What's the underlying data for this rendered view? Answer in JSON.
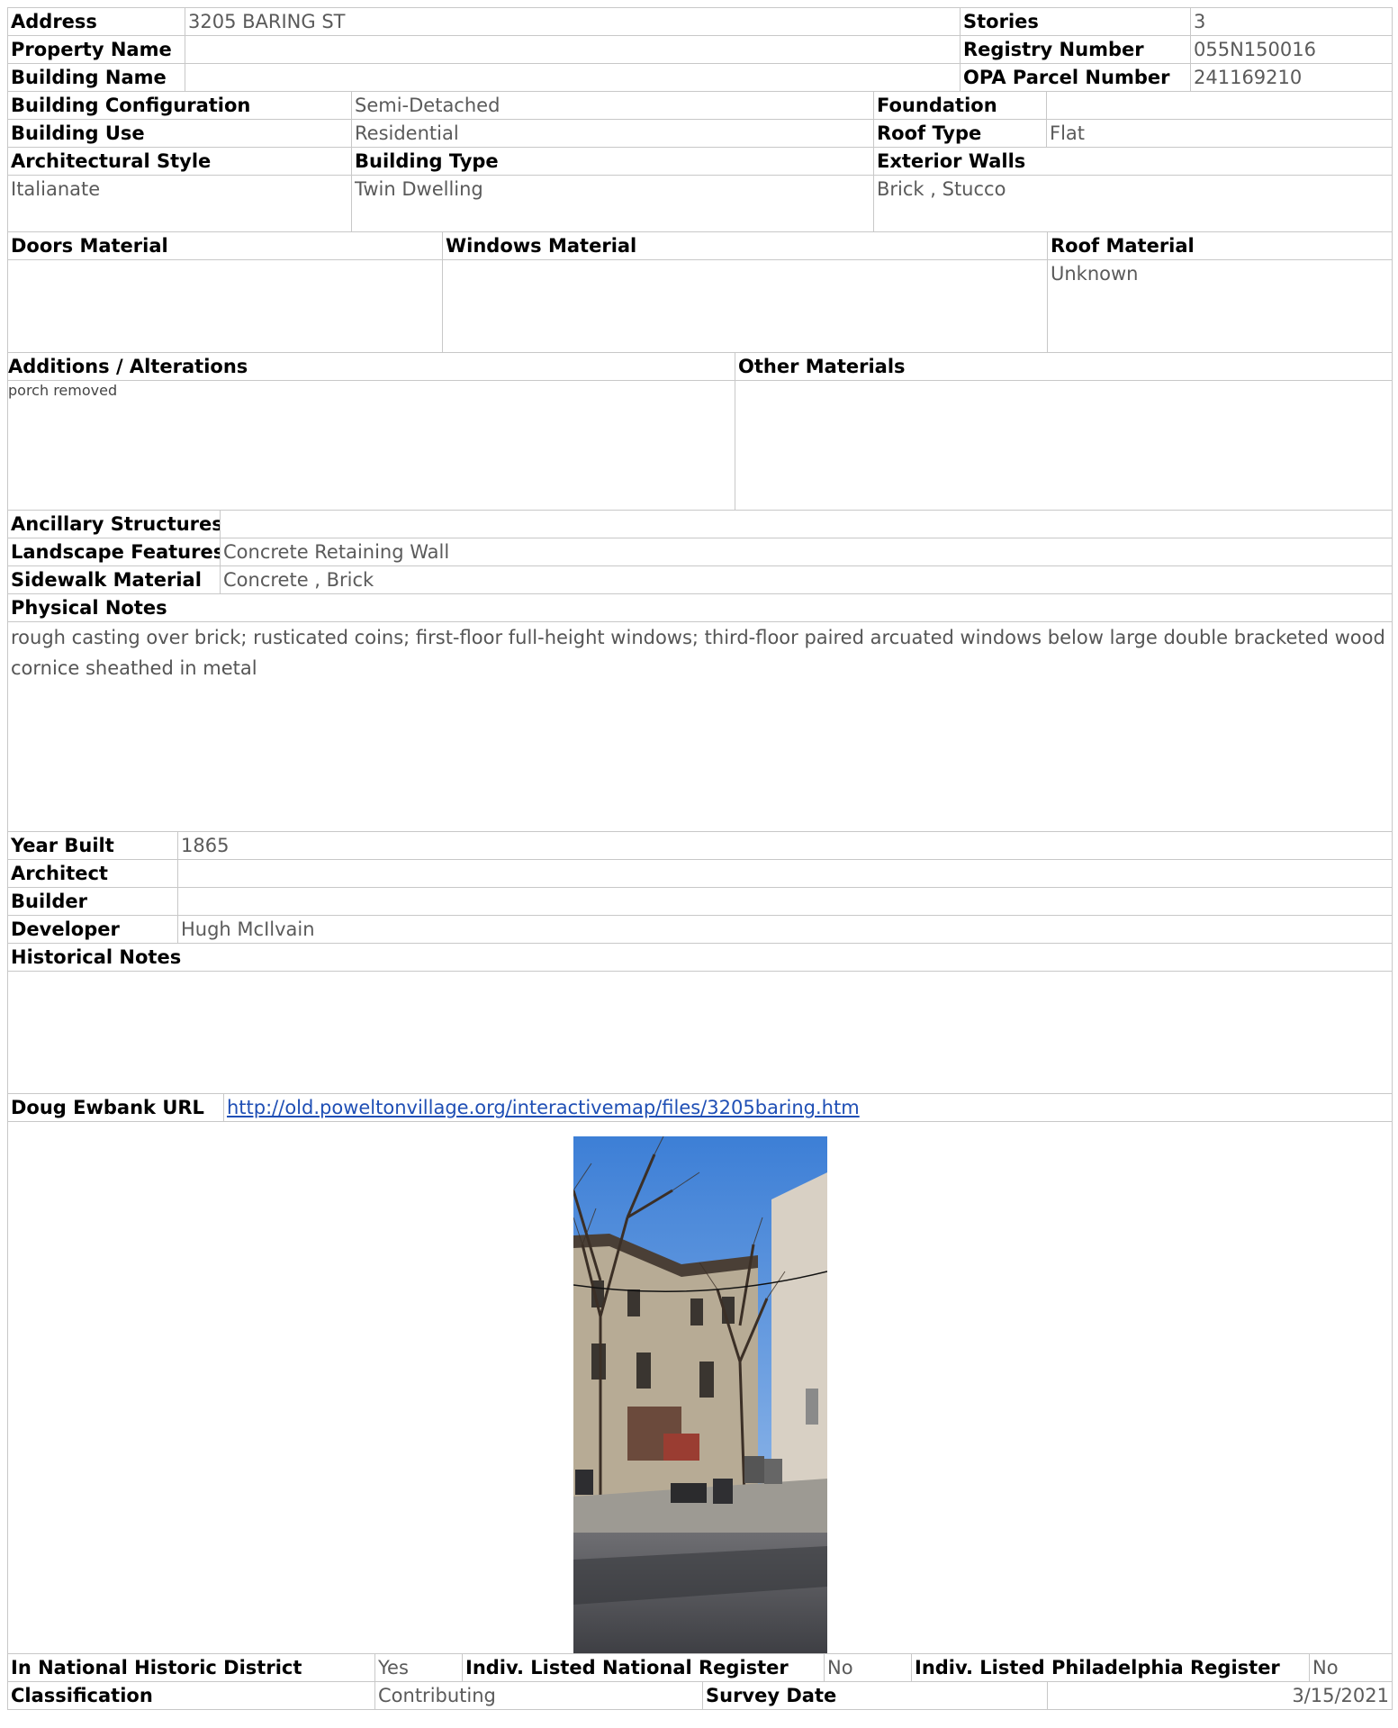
{
  "labels": {
    "address": "Address",
    "property_name": "Property Name",
    "building_name": "Building Name",
    "stories": "Stories",
    "registry_number": "Registry Number",
    "opa_parcel_number": "OPA Parcel Number",
    "building_configuration": "Building Configuration",
    "foundation": "Foundation",
    "building_use": "Building Use",
    "roof_type": "Roof Type",
    "architectural_style": "Architectural Style",
    "building_type": "Building Type",
    "exterior_walls": "Exterior Walls",
    "doors_material": "Doors Material",
    "windows_material": "Windows Material",
    "roof_material": "Roof Material",
    "additions": "Additions / Alterations",
    "other_materials": "Other Materials",
    "ancillary_structures": "Ancillary Structures",
    "landscape_features": "Landscape Features",
    "sidewalk_material": "Sidewalk Material",
    "physical_notes": "Physical Notes",
    "year_built": "Year Built",
    "architect": "Architect",
    "builder": "Builder",
    "developer": "Developer",
    "historical_notes": "Historical Notes",
    "doug_ewbank_url": "Doug Ewbank URL",
    "in_national_historic_district": "In National Historic District",
    "indiv_listed_national": "Indiv. Listed National Register",
    "indiv_listed_philadelphia": "Indiv. Listed Philadelphia Register",
    "classification": "Classification",
    "survey_date": "Survey Date"
  },
  "values": {
    "address": "3205 BARING ST",
    "property_name": "",
    "building_name": "",
    "stories": "3",
    "registry_number": "055N150016",
    "opa_parcel_number": "241169210",
    "building_configuration": "Semi-Detached",
    "foundation": "",
    "building_use": "Residential",
    "roof_type": "Flat",
    "architectural_style": "Italianate",
    "building_type": "Twin Dwelling",
    "exterior_walls": "Brick , Stucco",
    "doors_material": "",
    "windows_material": "",
    "roof_material": "Unknown",
    "additions": "porch removed",
    "other_materials": "",
    "ancillary_structures": "",
    "landscape_features": "Concrete Retaining Wall",
    "sidewalk_material": "Concrete , Brick",
    "physical_notes": "rough casting over brick; rusticated coins; first-floor full-height windows; third-floor paired arcuated windows below large double bracketed wood cornice sheathed in metal",
    "year_built": "1865",
    "architect": "",
    "builder": "",
    "developer": "Hugh McIlvain",
    "historical_notes": "",
    "doug_ewbank_url": "http://old.poweltonvillage.org/interactivemap/files/3205baring.htm",
    "in_national_historic_district": "Yes",
    "indiv_listed_national": "No",
    "indiv_listed_philadelphia": "No",
    "classification": "Contributing",
    "survey_date": "3/15/2021"
  },
  "colors": {
    "border": "#c8c8c8",
    "value_text": "#5a5a5a",
    "link": "#1f4fb5"
  }
}
